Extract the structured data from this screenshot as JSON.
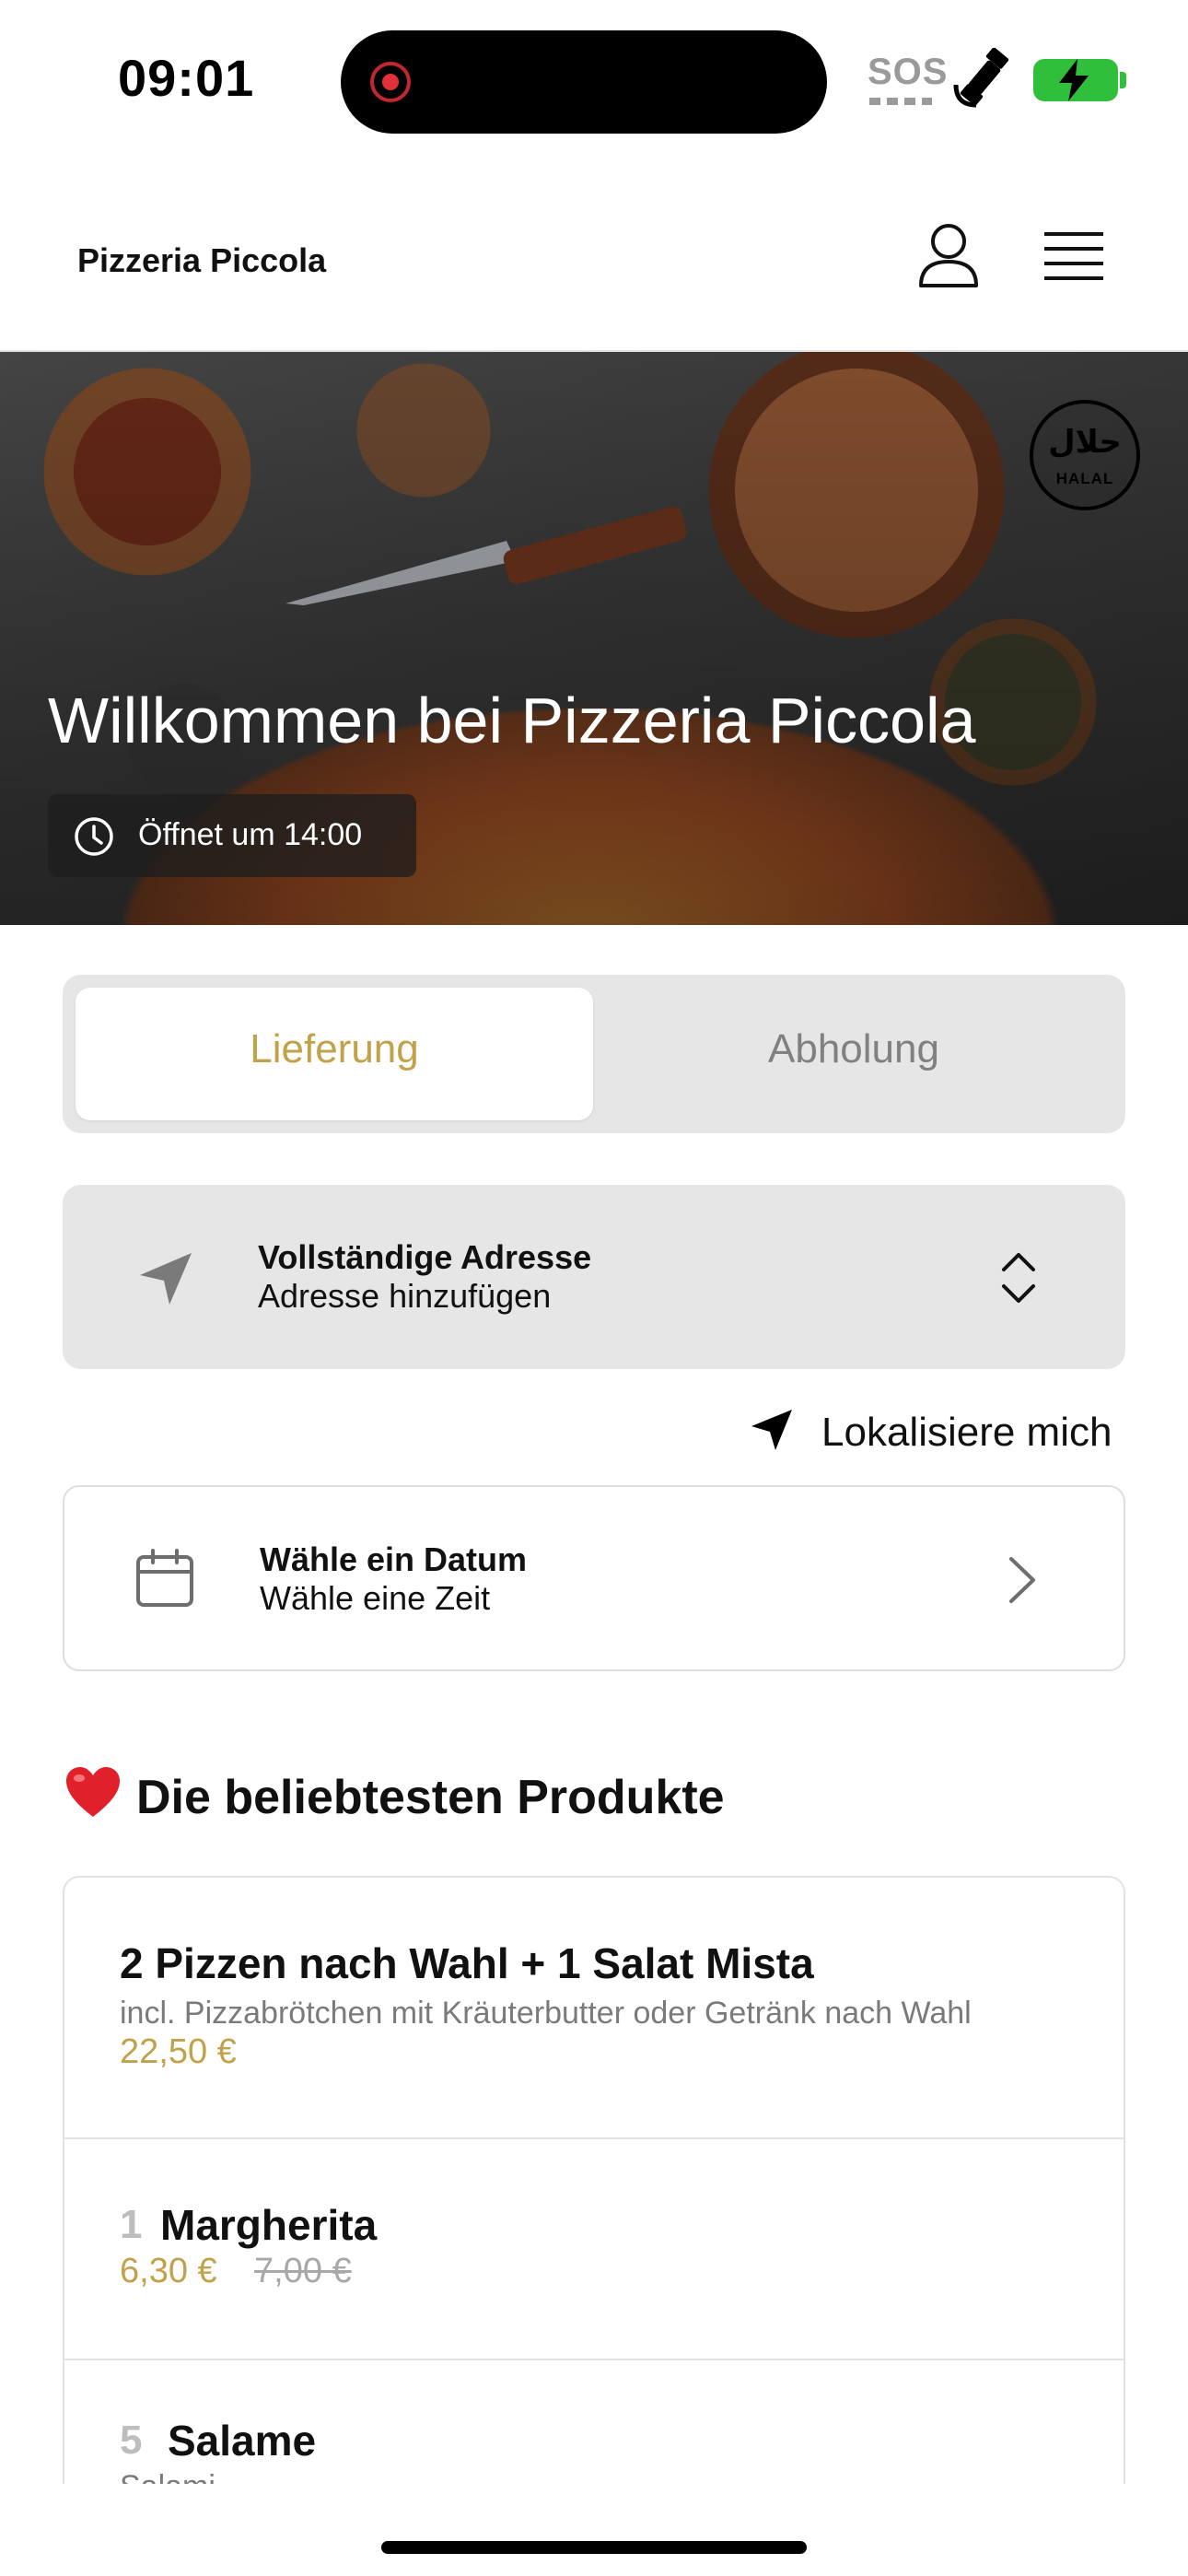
{
  "status_bar": {
    "time": "09:01",
    "sos_label": "SOS",
    "icons": [
      "recording-icon",
      "satellite-icon",
      "battery-charging-icon"
    ]
  },
  "header": {
    "brand": "Pizzeria Piccola",
    "icons": [
      "user-icon",
      "hamburger-menu-icon"
    ]
  },
  "hero": {
    "title": "Willkommen bei Pizzeria Piccola",
    "hours": "Öffnet um 14:00",
    "badge_text": "HALAL",
    "badge_arabic": "حلال"
  },
  "order_mode": {
    "options": [
      "Lieferung",
      "Abholung"
    ],
    "selected": "Lieferung"
  },
  "address": {
    "title": "Vollständige Adresse",
    "subtitle": "Adresse hinzufügen"
  },
  "locate": {
    "label": "Lokalisiere mich"
  },
  "date_picker": {
    "title": "Wähle ein Datum",
    "subtitle": "Wähle eine Zeit"
  },
  "popular": {
    "title": "Die beliebtesten Produkte",
    "products": [
      {
        "name": "2 Pizzen nach Wahl + 1 Salat Mista",
        "description": "incl. Pizzabrötchen mit Kräuterbutter oder Getränk nach Wahl",
        "price": "22,50 €"
      },
      {
        "number": "1",
        "name": "Margherita",
        "price": "6,30 €",
        "old_price": "7,00 €"
      },
      {
        "number": "5",
        "name": "Salame",
        "description": "Salami"
      }
    ]
  },
  "colors": {
    "accent": "#c1a24a",
    "segment_bg": "#e6e6e6",
    "muted": "#808080"
  }
}
